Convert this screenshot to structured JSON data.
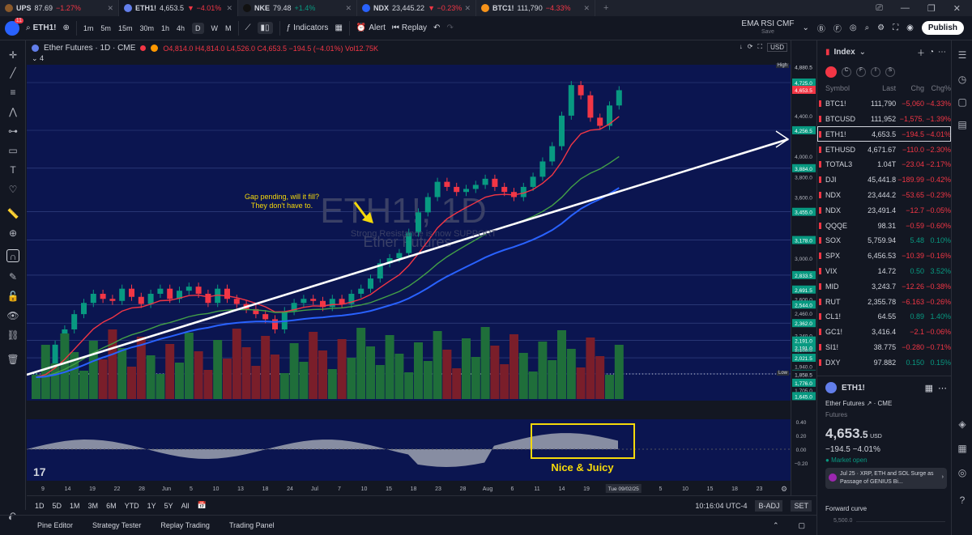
{
  "tabs": [
    {
      "name": "UPS",
      "price": "87.69",
      "change": "−1.27%",
      "dir": "neg",
      "color": "#8b5a2b",
      "active": false
    },
    {
      "name": "ETH1!",
      "price": "4,653.5",
      "change": "▼ −4.01%",
      "dir": "neg",
      "color": "#627eea",
      "active": true
    },
    {
      "name": "NKE",
      "price": "79.48",
      "change": "+1.4%",
      "dir": "pos",
      "color": "#111",
      "active": false
    },
    {
      "name": "NDX",
      "price": "23,445.22",
      "change": "▼ −0.23%",
      "dir": "neg",
      "color": "#2962ff",
      "active": false
    },
    {
      "name": "BTC1!",
      "price": "111,790",
      "change": "−4.33%",
      "dir": "neg",
      "color": "#f7931a",
      "active": false
    }
  ],
  "toolbar": {
    "avatar_badge": "11",
    "symbol": "ETH1!",
    "intervals": [
      "1m",
      "5m",
      "15m",
      "30m",
      "1h",
      "4h",
      "D",
      "W",
      "M"
    ],
    "selected_interval": "D",
    "indicators": "Indicators",
    "alert": "Alert",
    "replay": "Replay",
    "layout_name": "EMA RSI CMF",
    "layout_sub": "Save",
    "publish": "Publish"
  },
  "legend": {
    "title": "Ether Futures · 1D · CME",
    "ohlc": "O4,814.0 H4,814.0 L4,526.0 C4,653.5 −194.5 (−4.01%) Vol12.75K",
    "count": "4",
    "currency": "USD"
  },
  "watermark": {
    "big": "ETH1!, 1D",
    "small": "Ether Futures"
  },
  "annotations": {
    "gap": "Gap pending, will it fill? They don't have to.",
    "support": "Strong Resistance is now SUPPORT",
    "juicy": "Nice & Juicy"
  },
  "price_axis": {
    "labels": [
      "4,880.5",
      "4,725.0",
      "4,653.5",
      "4,400.0",
      "4,256.5",
      "4,000.0",
      "3,884.0",
      "3,800.0",
      "3,600.0",
      "3,455.0",
      "3,178.0",
      "3,000.0",
      "2,833.5",
      "2,691.5",
      "2,600.0",
      "2,544.0",
      "2,460.0",
      "2,362.0",
      "2,240.0",
      "2,191.0",
      "2,191.0",
      "2,100.0",
      "2,021.5",
      "1,940.0",
      "1,863.5",
      "1,858.5",
      "1,776.0",
      "1,705.0",
      "1,645.0"
    ],
    "high_tag": "High",
    "low_tag": "Low",
    "osc_labels": [
      "0.40",
      "0.20",
      "0.00",
      "−0.20"
    ]
  },
  "time_axis": {
    "labels": [
      "9",
      "14",
      "19",
      "22",
      "28",
      "Jun",
      "5",
      "10",
      "13",
      "18",
      "24",
      "Jul",
      "7",
      "10",
      "15",
      "18",
      "23",
      "28",
      "Aug",
      "6",
      "11",
      "14",
      "19",
      "22",
      "27",
      "5",
      "10",
      "15",
      "18",
      "23"
    ],
    "cursor": "Tue 09/02/25"
  },
  "bottom_bar": {
    "ranges": [
      "1D",
      "5D",
      "1M",
      "3M",
      "6M",
      "YTD",
      "1Y",
      "5Y",
      "All"
    ],
    "clock": "10:16:04 UTC-4",
    "badj": "B-ADJ",
    "set": "SET"
  },
  "bottom_tabs": [
    "Pine Editor",
    "Strategy Tester",
    "Replay Trading",
    "Trading Panel"
  ],
  "watchlist": {
    "title": "Index",
    "headers": [
      "Symbol",
      "Last",
      "Chg",
      "Chg%"
    ],
    "rows": [
      {
        "sym": "BTC1!",
        "last": "111,790",
        "chg": "−5,060",
        "pct": "−4.33%",
        "dir": "neg",
        "sel": false
      },
      {
        "sym": "BTCUSD",
        "last": "111,952",
        "chg": "−1,575.",
        "pct": "−1.39%",
        "dir": "neg",
        "sel": false
      },
      {
        "sym": "ETH1!",
        "last": "4,653.5",
        "chg": "−194.5",
        "pct": "−4.01%",
        "dir": "neg",
        "sel": true
      },
      {
        "sym": "ETHUSD",
        "last": "4,671.67",
        "chg": "−110.0",
        "pct": "−2.30%",
        "dir": "neg",
        "sel": false
      },
      {
        "sym": "TOTAL3",
        "last": "1.04T",
        "chg": "−23.04",
        "pct": "−2.17%",
        "dir": "neg",
        "sel": false
      },
      {
        "sym": "DJI",
        "last": "45,441.8",
        "chg": "−189.99",
        "pct": "−0.42%",
        "dir": "neg",
        "sel": false
      },
      {
        "sym": "NDX",
        "last": "23,444.2",
        "chg": "−53.65",
        "pct": "−0.23%",
        "dir": "neg",
        "sel": false
      },
      {
        "sym": "NDX",
        "last": "23,491.4",
        "chg": "−12.7",
        "pct": "−0.05%",
        "dir": "neg",
        "sel": false
      },
      {
        "sym": "QQQE",
        "last": "98.31",
        "chg": "−0.59",
        "pct": "−0.60%",
        "dir": "neg",
        "sel": false
      },
      {
        "sym": "SOX",
        "last": "5,759.94",
        "chg": "5.48",
        "pct": "0.10%",
        "dir": "pos",
        "sel": false
      },
      {
        "sym": "SPX",
        "last": "6,456.53",
        "chg": "−10.39",
        "pct": "−0.16%",
        "dir": "neg",
        "sel": false
      },
      {
        "sym": "VIX",
        "last": "14.72",
        "chg": "0.50",
        "pct": "3.52%",
        "dir": "pos",
        "sel": false
      },
      {
        "sym": "MID",
        "last": "3,243.7",
        "chg": "−12.26",
        "pct": "−0.38%",
        "dir": "neg",
        "sel": false
      },
      {
        "sym": "RUT",
        "last": "2,355.78",
        "chg": "−6.163",
        "pct": "−0.26%",
        "dir": "neg",
        "sel": false
      },
      {
        "sym": "CL1!",
        "last": "64.55",
        "chg": "0.89",
        "pct": "1.40%",
        "dir": "pos",
        "sel": false
      },
      {
        "sym": "GC1!",
        "last": "3,416.4",
        "chg": "−2.1",
        "pct": "−0.06%",
        "dir": "neg",
        "sel": false
      },
      {
        "sym": "SI1!",
        "last": "38.775",
        "chg": "−0.280",
        "pct": "−0.71%",
        "dir": "neg",
        "sel": false
      },
      {
        "sym": "DXY",
        "last": "97.882",
        "chg": "0.150",
        "pct": "0.15%",
        "dir": "pos",
        "sel": false
      }
    ]
  },
  "detail": {
    "symbol": "ETH1!",
    "name": "Ether Futures",
    "exchange": "CME",
    "type": "Futures",
    "price_main": "4,653",
    "price_dec": ".5",
    "currency": "USD",
    "change": "−194.5 −4.01%",
    "status": "Market open",
    "news": "Jul 25 · XRP, ETH and SOL Surge as Passage of GENIUS Bi...",
    "curve_title": "Forward curve",
    "curve_val": "5,500.0"
  },
  "colors": {
    "up": "#089981",
    "down": "#f23645",
    "ema_fast": "#f23645",
    "ema_mid": "#43a047",
    "ema_slow": "#2962ff",
    "trendline": "#ffffff",
    "annot": "#f5d90a"
  }
}
